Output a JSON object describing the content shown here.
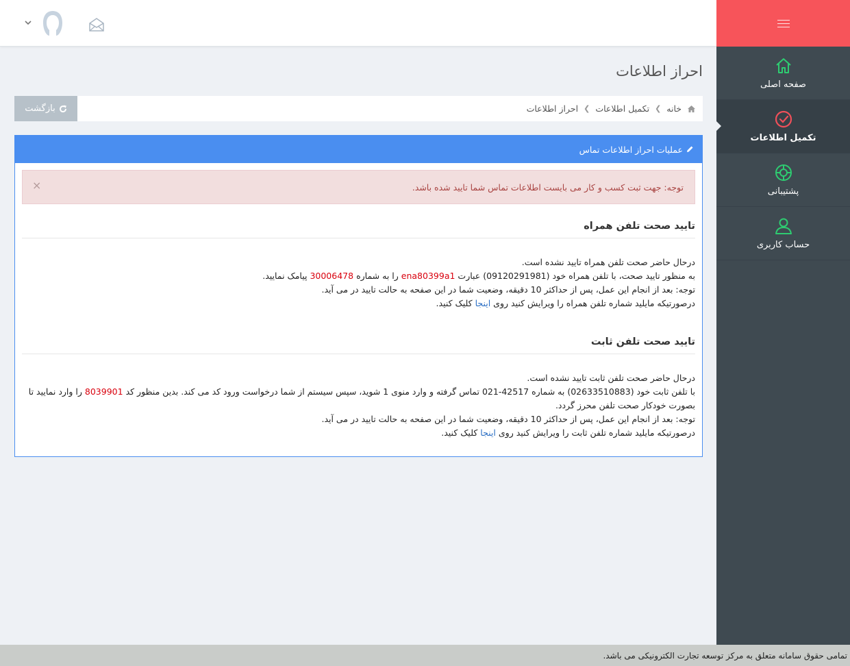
{
  "header": {
    "icons": [
      "chevron-down-icon",
      "user-avatar-icon",
      "envelope-icon"
    ]
  },
  "sidebar": {
    "brand_icon": "hamburger-icon",
    "items": [
      {
        "label": "صفحه اصلی",
        "icon": "home-icon",
        "color": "#2ecc71"
      },
      {
        "label": "تکمیل اطلاعات",
        "icon": "check-circle-icon",
        "color": "#f0505a",
        "active": true
      },
      {
        "label": "پشتیبانی",
        "icon": "lifebuoy-icon",
        "color": "#2ecc71"
      },
      {
        "label": "حساب کاربری",
        "icon": "user-icon",
        "color": "#2ecc71"
      }
    ]
  },
  "page": {
    "title": "احراز اطلاعات",
    "back_label": "بازگشت",
    "breadcrumb": {
      "home": "خانه",
      "level2": "تکمیل اطلاعات",
      "current": "احراز اطلاعات"
    }
  },
  "panel": {
    "heading": "عملیات احراز اطلاعات تماس",
    "alert_text": "توجه: جهت ثبت کسب و کار می بایست اطلاعات تماس شما تایید شده باشد.",
    "alert_close": "×"
  },
  "mobile": {
    "title": "تایید صحت تلفن همراه",
    "line1": "درحال حاضر صحت تلفن همراه تایید نشده است.",
    "line2_a": "به منظور تایید صحت، با تلفن همراه خود (09120291981) عبارت",
    "code": "ena80399a1",
    "line2_b": "را به شماره",
    "sms_number": "30006478",
    "line2_c": "پیامک نمایید.",
    "line3": "توجه: بعد از انجام این عمل، پس از حداکثر 10 دقیقه، وضعیت شما در این صفحه به حالت تایید در می آید.",
    "line4_a": "درصورتیکه مایلید شماره تلفن همراه را ویرایش کنید روی",
    "line4_link": "اینجا",
    "line4_b": "کلیک کنید."
  },
  "landline": {
    "title": "تایید صحت تلفن ثابت",
    "line1": "درحال حاضر صحت تلفن ثابت تایید نشده است.",
    "line2_a": "با تلفن ثابت خود (02633510883) به شماره 42517-021 تماس گرفته و وارد منوی 1 شوید، سپس سیستم از شما درخواست ورود کد می کند. بدین منظور کد",
    "code": "8039901",
    "line2_b": "را وارد نمایید تا بصورت خودکار صحت تلفن محرز گردد.",
    "line3": "توجه: بعد از انجام این عمل، پس از حداکثر 10 دقیقه، وضعیت شما در این صفحه به حالت تایید در می آید.",
    "line4_a": "درصورتیکه مایلید شماره تلفن ثابت را ویرایش کنید روی",
    "line4_link": "اینجا",
    "line4_b": "کلیک کنید."
  },
  "footer": {
    "text": "تمامی حقوق سامانه متعلق به مرکز توسعه تجارت الکترونیکی می باشد."
  }
}
